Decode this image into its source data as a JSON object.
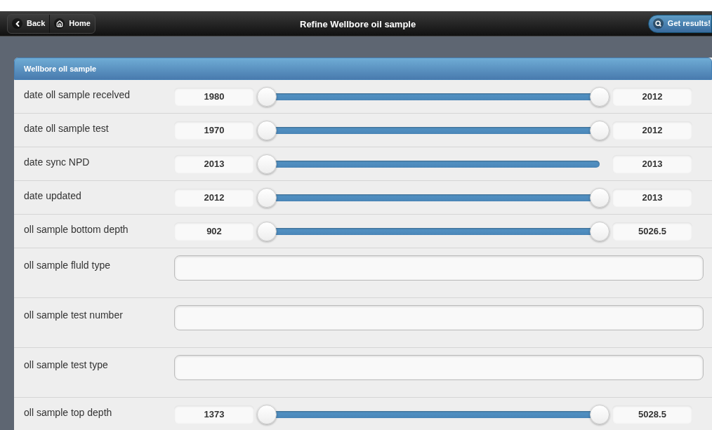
{
  "header": {
    "back_button": "Back",
    "home_button": "Home",
    "title": "Refine Wellbore oil sample",
    "results_button": "Get results!"
  },
  "panel": {
    "title": "Wellbore oll sample",
    "rows": [
      {
        "kind": "range",
        "label": "date oll sample recelved",
        "min": "1980",
        "max": "2012",
        "thumbs": [
          {
            "level": 0
          },
          {
            "level": 1
          }
        ]
      },
      {
        "kind": "range",
        "label": "date oll sample test",
        "min": "1970",
        "max": "2012",
        "thumbs": [
          {
            "level": 0
          },
          {
            "level": 1
          }
        ]
      },
      {
        "kind": "range",
        "label": "date sync NPD",
        "min": "2013",
        "max": "2013",
        "thumbs": [
          {
            "level": 0
          }
        ]
      },
      {
        "kind": "range",
        "label": "date updated",
        "min": "2012",
        "max": "2013",
        "thumbs": [
          {
            "level": 0
          },
          {
            "level": 1
          }
        ]
      },
      {
        "kind": "range",
        "label": "oll sample bottom depth",
        "min": "902",
        "max": "5026.5",
        "thumbs": [
          {
            "level": 0
          },
          {
            "level": 1
          }
        ]
      },
      {
        "kind": "text",
        "label": "oll sample fluld type"
      },
      {
        "kind": "text",
        "label": "oll sample test number"
      },
      {
        "kind": "text",
        "label": "oll sample test type"
      },
      {
        "kind": "range",
        "label": "oll sample top depth",
        "min": "1373",
        "max": "5028.5",
        "thumbs": [
          {
            "level": 0
          },
          {
            "level": 1
          }
        ]
      }
    ]
  }
}
